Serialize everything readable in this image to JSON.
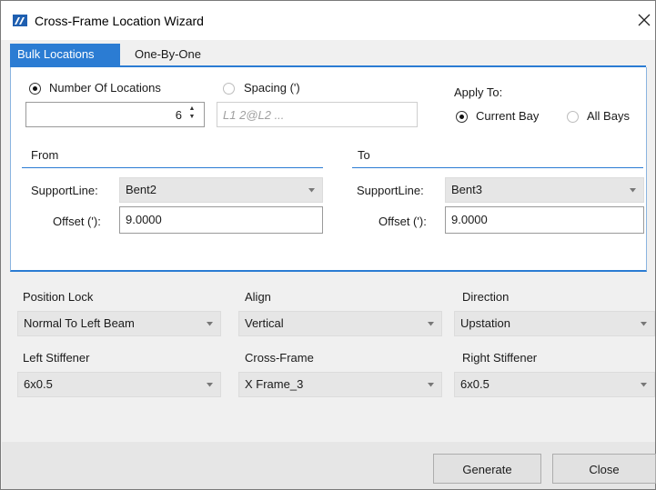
{
  "window": {
    "title": "Cross-Frame Location Wizard"
  },
  "tabs": [
    {
      "label": "Bulk Locations",
      "active": true
    },
    {
      "label": "One-By-One",
      "active": false
    }
  ],
  "locations": {
    "number_label": "Number Of Locations",
    "number_checked": true,
    "number_value": "6",
    "spacing_label": "Spacing (')",
    "spacing_checked": false,
    "spacing_placeholder": "L1 2@L2 ..."
  },
  "apply_to": {
    "label": "Apply To:",
    "current_bay": "Current Bay",
    "current_bay_checked": true,
    "all_bays": "All Bays",
    "all_bays_checked": false
  },
  "from": {
    "title": "From",
    "supportline_label": "SupportLine:",
    "supportline_value": "Bent2",
    "offset_label": "Offset ('):",
    "offset_value": "9.0000"
  },
  "to": {
    "title": "To",
    "supportline_label": "SupportLine:",
    "supportline_value": "Bent3",
    "offset_label": "Offset ('):",
    "offset_value": "9.0000"
  },
  "options": {
    "position_lock_label": "Position Lock",
    "position_lock_value": "Normal To Left Beam",
    "align_label": "Align",
    "align_value": "Vertical",
    "direction_label": "Direction",
    "direction_value": "Upstation",
    "left_stiffener_label": "Left Stiffener",
    "left_stiffener_value": "6x0.5",
    "cross_frame_label": "Cross-Frame",
    "cross_frame_value": "X Frame_3",
    "right_stiffener_label": "Right Stiffener",
    "right_stiffener_value": "6x0.5"
  },
  "buttons": {
    "generate": "Generate",
    "close": "Close"
  },
  "colors": {
    "accent": "#2b7cd3",
    "combo_bg": "#e6e6e6"
  },
  "icons": {
    "app": "bridge-app-icon",
    "close": "close-icon",
    "dropdown": "chevron-down-icon",
    "spin": "spin-arrows-icon"
  }
}
